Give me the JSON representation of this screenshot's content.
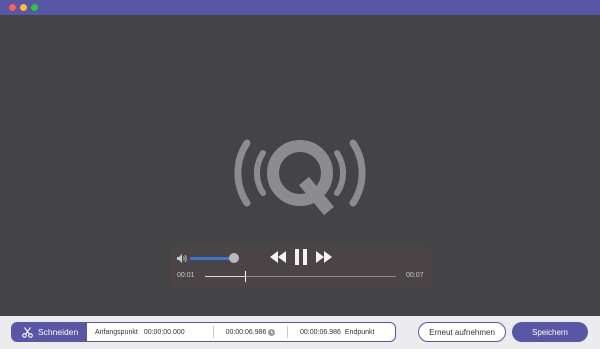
{
  "window": {
    "controls": [
      "close-dot",
      "minimize-dot",
      "zoom-dot"
    ]
  },
  "player": {
    "time_current": "00:01",
    "time_total": "00:07",
    "progress": 0.21,
    "volume": 0.9
  },
  "toolbar": {
    "cut_label": "Schneiden",
    "start_label": "Anfangspunkt",
    "start_value": "00:00:00.000",
    "duration_value": "00:00:06.986",
    "end_value": "00:00:06.986",
    "end_label": "Endpunkt",
    "reset_label": "Erneut aufnehmen",
    "save_label": "Speichern"
  },
  "colors": {
    "accent": "#5757a6",
    "stage": "#444446",
    "volume": "#3a78d6"
  }
}
